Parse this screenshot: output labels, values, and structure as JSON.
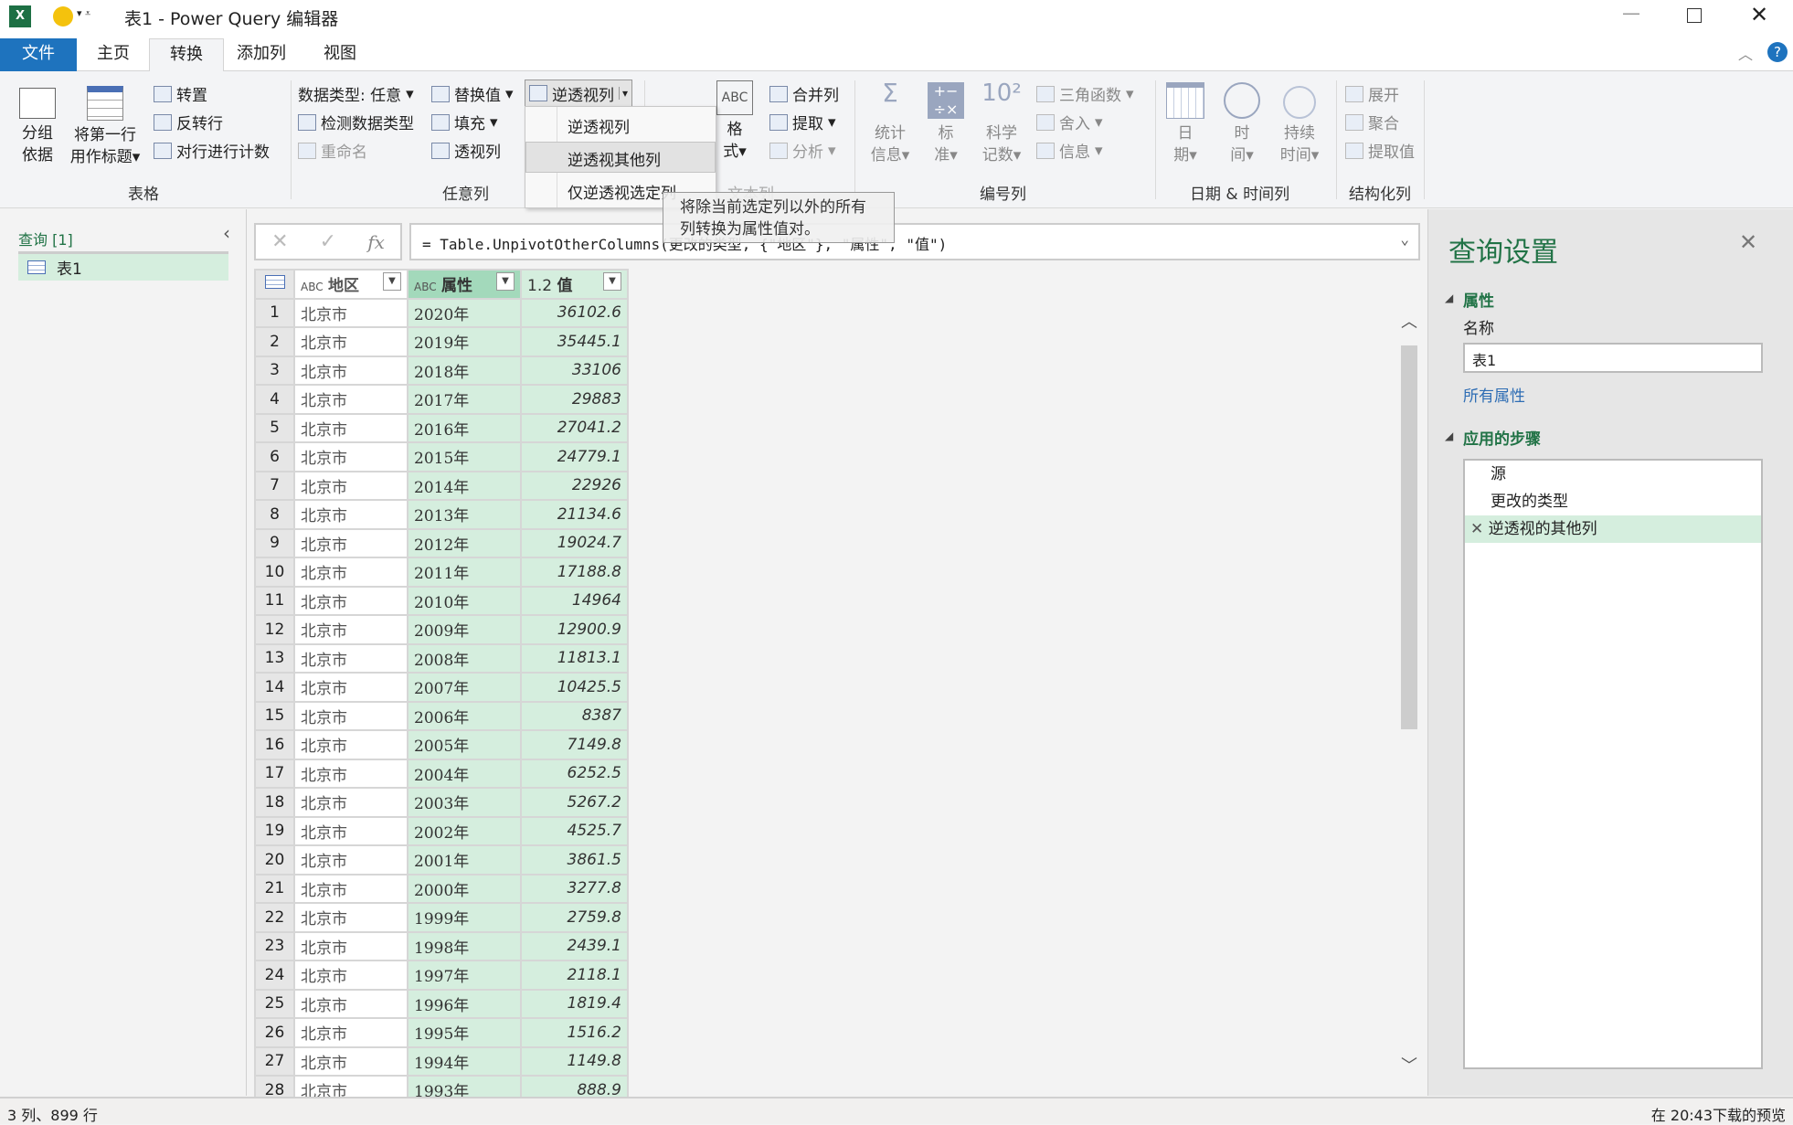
{
  "window": {
    "title": "表1 - Power Query 编辑器"
  },
  "tabs": [
    "文件",
    "主页",
    "转换",
    "添加列",
    "视图"
  ],
  "ribbon": {
    "table_group": {
      "label": "表格",
      "group_by": [
        "分组",
        "依据"
      ],
      "use_first_row": [
        "将第一行",
        "用作标题"
      ],
      "transpose": "转置",
      "reverse_rows": "反转行",
      "count_rows": "对行进行计数"
    },
    "any_column_group": {
      "label": "任意列",
      "data_type": "数据类型: 任意",
      "detect_type": "检测数据类型",
      "rename": "重命名",
      "replace_values": "替换值",
      "fill": "填充",
      "pivot": "透视列",
      "unpivot": "逆透视列"
    },
    "text_group": {
      "label": "文本列",
      "format": [
        "格",
        "式"
      ],
      "merge": "合并列",
      "extract": "提取",
      "parse": "分析"
    },
    "number_group": {
      "label": "编号列",
      "statistics": [
        "统计",
        "信息"
      ],
      "standard": [
        "标",
        "准"
      ],
      "scientific": [
        "科学",
        "记数"
      ],
      "trig": "三角函数",
      "rounding": "舍入",
      "info": "信息"
    },
    "datetime_group": {
      "label": "日期 & 时间列",
      "date": [
        "日",
        "期"
      ],
      "time": [
        "时",
        "间"
      ],
      "duration": [
        "持续",
        "时间"
      ]
    },
    "structured_group": {
      "label": "结构化列",
      "expand": "展开",
      "aggregate": "聚合",
      "extract_values": "提取值"
    }
  },
  "unpivot_menu": {
    "items": [
      "逆透视列",
      "逆透视其他列",
      "仅逆透视选定列"
    ],
    "selected": 1
  },
  "tooltip": "将除当前选定列以外的所有列转换为属性值对。",
  "queries": {
    "header": "查询 [1]",
    "items": [
      "表1"
    ]
  },
  "formula": "= Table.UnpivotOtherColumns(更改的类型, {\"地区\"}, \"属性\", \"值\")",
  "grid": {
    "columns": [
      {
        "type": "ABC",
        "name": "地区"
      },
      {
        "type": "ABC",
        "name": "属性"
      },
      {
        "type": "1.2",
        "name": "值"
      }
    ],
    "rows": [
      [
        "北京市",
        "2020年",
        "36102.6"
      ],
      [
        "北京市",
        "2019年",
        "35445.1"
      ],
      [
        "北京市",
        "2018年",
        "33106"
      ],
      [
        "北京市",
        "2017年",
        "29883"
      ],
      [
        "北京市",
        "2016年",
        "27041.2"
      ],
      [
        "北京市",
        "2015年",
        "24779.1"
      ],
      [
        "北京市",
        "2014年",
        "22926"
      ],
      [
        "北京市",
        "2013年",
        "21134.6"
      ],
      [
        "北京市",
        "2012年",
        "19024.7"
      ],
      [
        "北京市",
        "2011年",
        "17188.8"
      ],
      [
        "北京市",
        "2010年",
        "14964"
      ],
      [
        "北京市",
        "2009年",
        "12900.9"
      ],
      [
        "北京市",
        "2008年",
        "11813.1"
      ],
      [
        "北京市",
        "2007年",
        "10425.5"
      ],
      [
        "北京市",
        "2006年",
        "8387"
      ],
      [
        "北京市",
        "2005年",
        "7149.8"
      ],
      [
        "北京市",
        "2004年",
        "6252.5"
      ],
      [
        "北京市",
        "2003年",
        "5267.2"
      ],
      [
        "北京市",
        "2002年",
        "4525.7"
      ],
      [
        "北京市",
        "2001年",
        "3861.5"
      ],
      [
        "北京市",
        "2000年",
        "3277.8"
      ],
      [
        "北京市",
        "1999年",
        "2759.8"
      ],
      [
        "北京市",
        "1998年",
        "2439.1"
      ],
      [
        "北京市",
        "1997年",
        "2118.1"
      ],
      [
        "北京市",
        "1996年",
        "1819.4"
      ],
      [
        "北京市",
        "1995年",
        "1516.2"
      ],
      [
        "北京市",
        "1994年",
        "1149.8"
      ],
      [
        "北京市",
        "1993年",
        "888.9"
      ]
    ]
  },
  "settings": {
    "title": "查询设置",
    "properties_header": "属性",
    "name_label": "名称",
    "name_value": "表1",
    "all_properties": "所有属性",
    "steps_header": "应用的步骤",
    "steps": [
      "源",
      "更改的类型",
      "逆透视的其他列"
    ],
    "selected_step": 2
  },
  "status": {
    "left": "3 列、899 行",
    "right": "在 20:43下载的预览"
  },
  "colors": {
    "accent": "#1e73be",
    "green_header": "#217346",
    "selected_col": "#d5eede"
  }
}
